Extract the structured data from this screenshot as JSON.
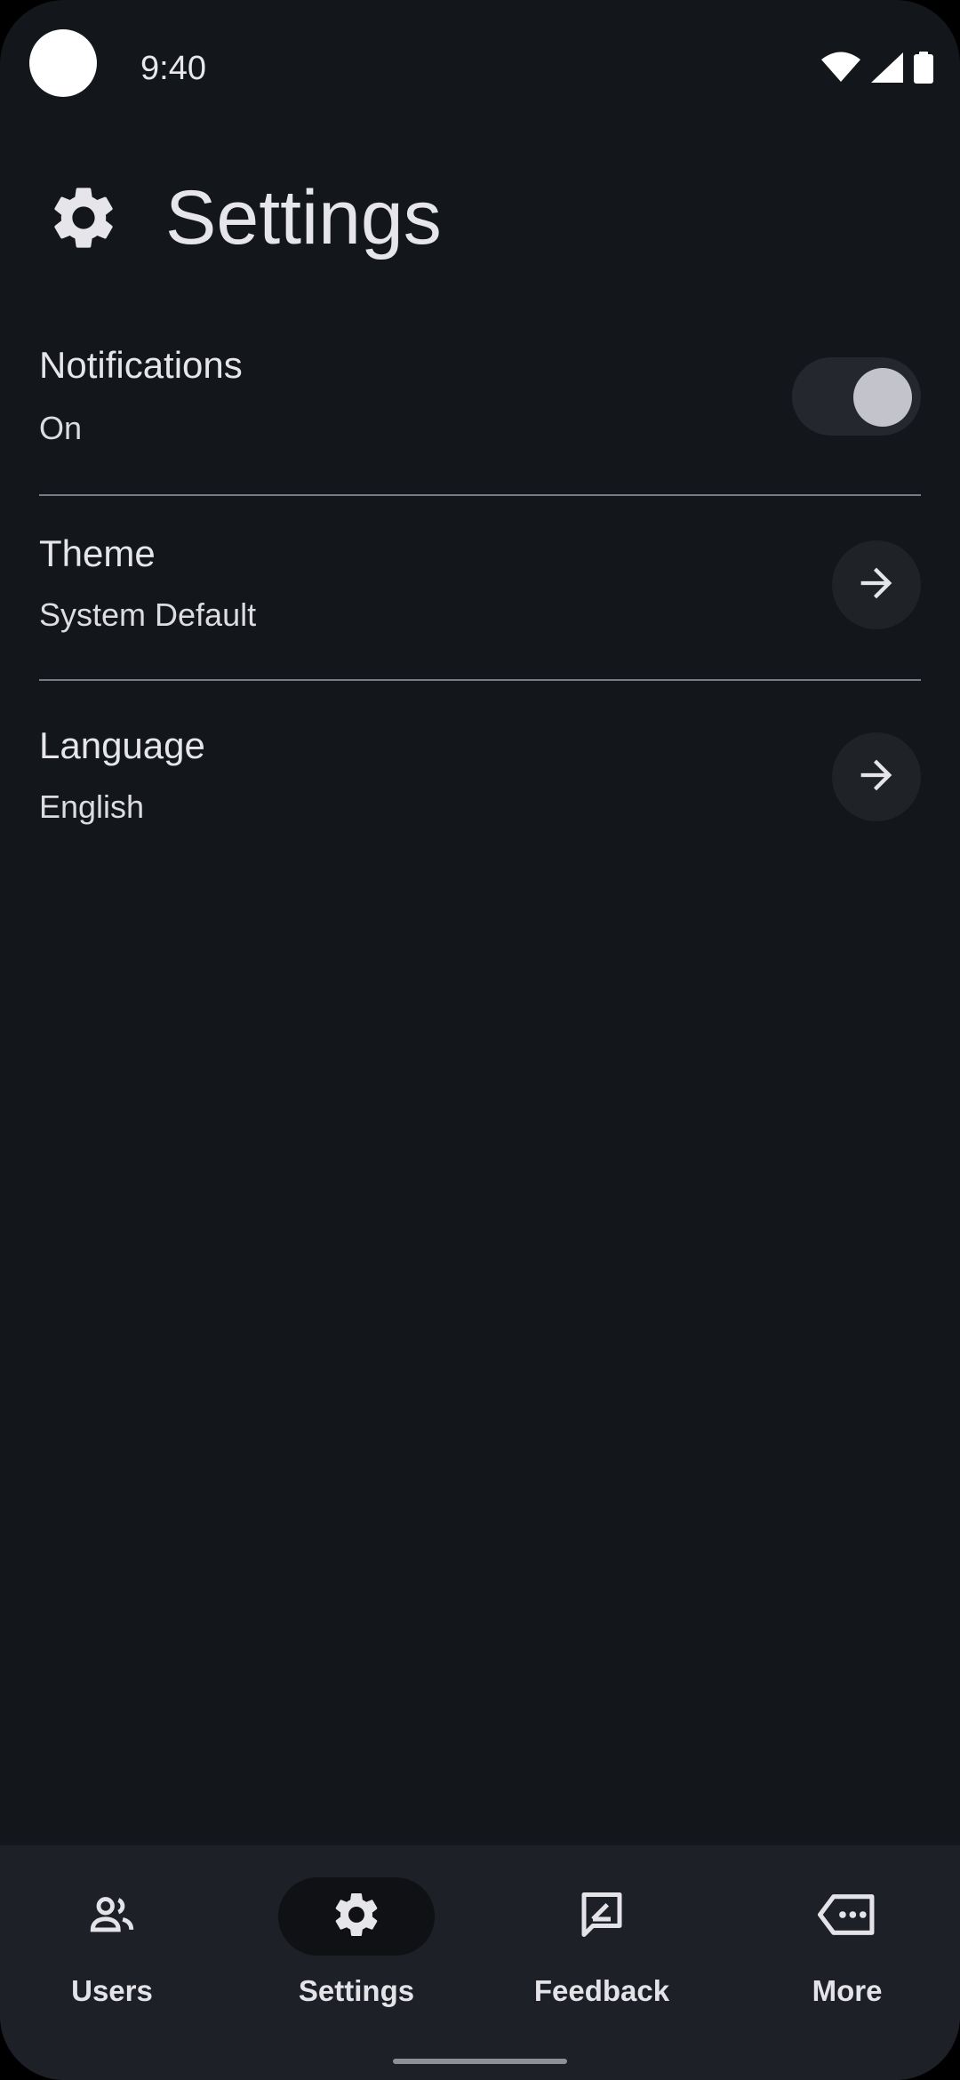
{
  "status_bar": {
    "time": "9:40",
    "icons": [
      "wifi-icon",
      "cellular-signal-icon",
      "battery-icon"
    ]
  },
  "header": {
    "icon": "gear-icon",
    "title": "Settings"
  },
  "settings": {
    "items": [
      {
        "title": "Notifications",
        "value": "On",
        "control": "toggle",
        "toggle_on": true
      },
      {
        "title": "Theme",
        "value": "System Default",
        "control": "arrow-right-icon"
      },
      {
        "title": "Language",
        "value": "English",
        "control": "arrow-right-icon"
      }
    ]
  },
  "bottom_nav": {
    "items": [
      {
        "label": "Users",
        "icon": "users-icon",
        "active": false
      },
      {
        "label": "Settings",
        "icon": "gear-icon",
        "active": true
      },
      {
        "label": "Feedback",
        "icon": "feedback-icon",
        "active": false
      },
      {
        "label": "More",
        "icon": "more-icon",
        "active": false
      }
    ]
  },
  "colors": {
    "background": "#13161b",
    "nav_background": "#1d2026",
    "text": "#e3e3e8",
    "active_pill": "#0f1115"
  }
}
